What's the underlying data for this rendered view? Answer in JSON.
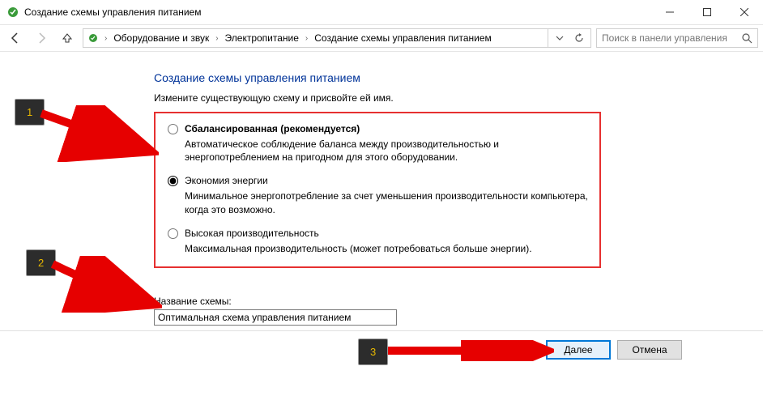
{
  "window": {
    "title": "Создание схемы управления питанием"
  },
  "breadcrumb": {
    "items": [
      "Оборудование и звук",
      "Электропитание",
      "Создание схемы управления питанием"
    ]
  },
  "search": {
    "placeholder": "Поиск в панели управления"
  },
  "page": {
    "title": "Создание схемы управления питанием",
    "subtitle": "Измените существующую схему и присвойте ей имя."
  },
  "plans": [
    {
      "name": "Сбалансированная (рекомендуется)",
      "bold": true,
      "desc": "Автоматическое соблюдение баланса между производительностью и энергопотреблением на пригодном для этого оборудовании.",
      "checked": false
    },
    {
      "name": "Экономия энергии",
      "bold": false,
      "desc": "Минимальное энергопотребление за счет уменьшения производительности компьютера, когда это возможно.",
      "checked": true
    },
    {
      "name": "Высокая производительность",
      "bold": false,
      "desc": "Максимальная производительность (может потребоваться больше энергии).",
      "checked": false
    }
  ],
  "planName": {
    "label": "Название схемы:",
    "value": "Оптимальная схема управления питанием"
  },
  "buttons": {
    "next": "Далее",
    "cancel": "Отмена"
  },
  "badges": [
    "1",
    "2",
    "3"
  ]
}
